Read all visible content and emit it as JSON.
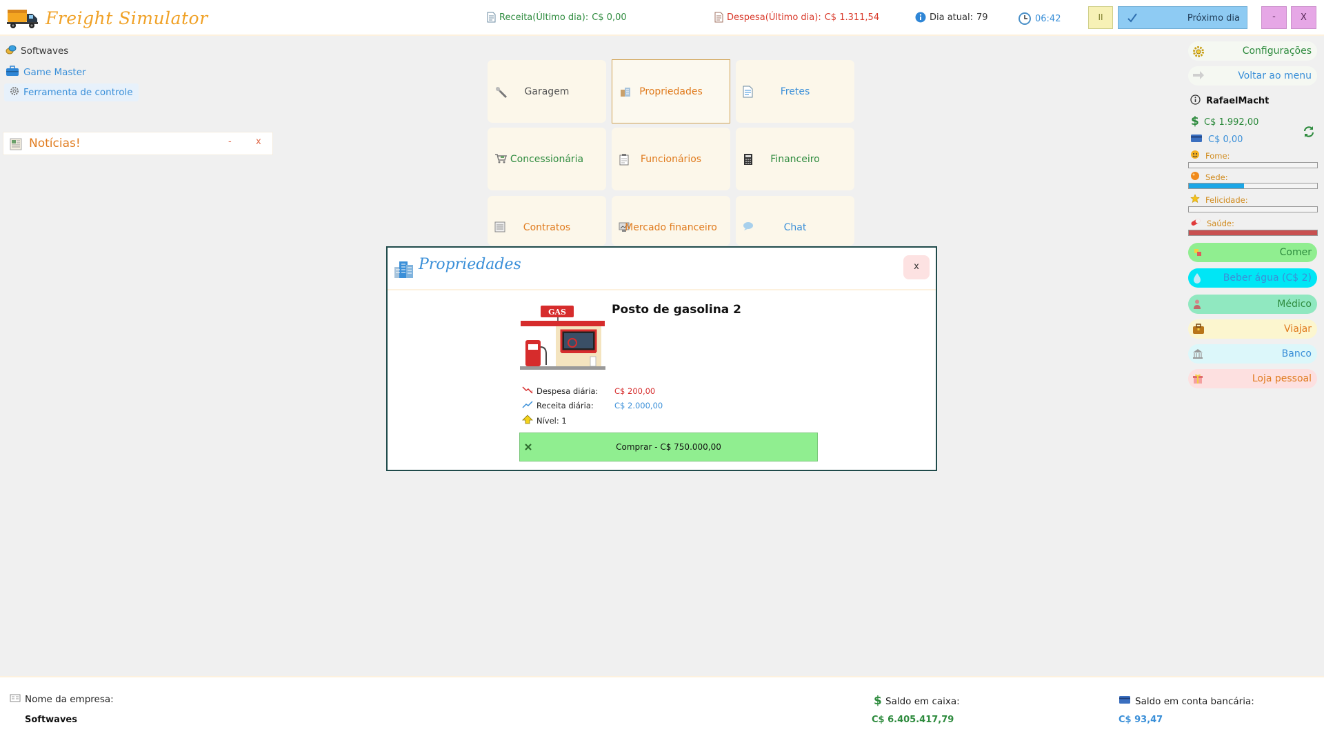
{
  "header": {
    "title": "Freight Simulator",
    "receita_label": "Receita(Último dia):",
    "receita_value": "C$  0,00",
    "despesa_label": "Despesa(Último dia):",
    "despesa_value": "C$  1.311,54",
    "dia_label": "Dia atual:",
    "dia_value": "79",
    "hora": "06:42",
    "pause_label": "II",
    "next_day_label": "Próximo dia",
    "minimize_label": "-",
    "close_label": "X"
  },
  "left": {
    "links": [
      "Softwaves",
      "Game Master",
      "Ferramenta de controle"
    ],
    "news": {
      "title": "Notícias!",
      "minimize": "-",
      "close": "x"
    }
  },
  "menu": {
    "tiles": [
      {
        "label": "Garagem",
        "icon": "wrench-icon"
      },
      {
        "label": "Propriedades",
        "icon": "building-icon"
      },
      {
        "label": "Fretes",
        "icon": "document-icon"
      },
      {
        "label": "Concessionária",
        "icon": "cart-icon"
      },
      {
        "label": "Funcionários",
        "icon": "clipboard-icon"
      },
      {
        "label": "Financeiro",
        "icon": "calculator-icon"
      },
      {
        "label": "Contratos",
        "icon": "contract-icon"
      },
      {
        "label": "Mercado financeiro",
        "icon": "market-icon"
      },
      {
        "label": "Chat",
        "icon": "chat-icon"
      }
    ]
  },
  "right": {
    "config_label": "Configurações",
    "menu_label": "Voltar ao menu",
    "username": "RafaelMacht",
    "cash": "C$  1.992,00",
    "bank": "C$  0,00",
    "stats": {
      "fome": {
        "label": "Fome:",
        "value": 0
      },
      "sede": {
        "label": "Sede:",
        "value": 0.43
      },
      "felicidade": {
        "label": "Felicidade:",
        "value": 0
      },
      "saude": {
        "label": "Saúde:",
        "value": 1.0
      }
    },
    "actions": {
      "comer": "Comer",
      "beber": "Beber água (C$ 2)",
      "medico": "Médico",
      "viajar": "Viajar",
      "banco": "Banco",
      "loja": "Loja pessoal"
    }
  },
  "modal": {
    "title": "Propriedades",
    "close_label": "x",
    "property_name": "Posto de gasolina 2",
    "image_sign": "GAS",
    "despesa_label": "Despesa diária:",
    "despesa_value": "C$  200,00",
    "receita_label": "Receita diária:",
    "receita_value": "C$  2.000,00",
    "nivel_label": "Nível: 1",
    "buy_label": "Comprar - C$  750.000,00"
  },
  "footer": {
    "empresa_label": "Nome da empresa:",
    "empresa_value": "Softwaves",
    "caixa_label": "Saldo em caixa:",
    "caixa_value": "C$  6.405.417,79",
    "banco_label": "Saldo em conta bancária:",
    "banco_value": "C$  93,47"
  },
  "colors": {
    "accent_orange": "#f0a126",
    "green": "#2e8b3e",
    "red": "#d93a2b",
    "blue": "#3a8fd8",
    "sede_bar": "#1ba6e6",
    "saude_bar": "#c85050"
  }
}
